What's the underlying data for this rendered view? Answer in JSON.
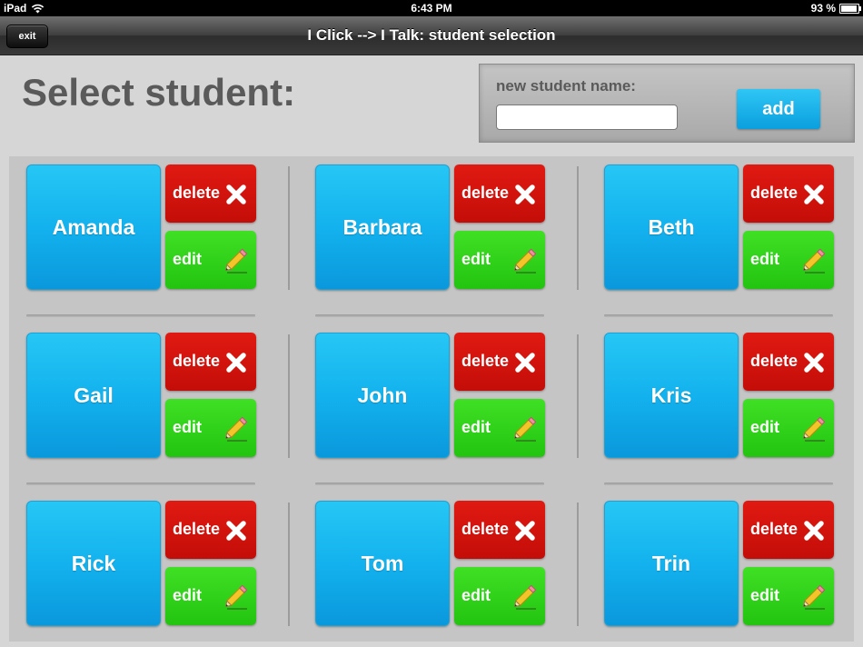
{
  "status_bar": {
    "device": "iPad",
    "time": "6:43 PM",
    "battery": "93 %",
    "battery_level": 0.93
  },
  "title_bar": {
    "exit_label": "exit",
    "title": "I Click --> I Talk: student selection"
  },
  "header": {
    "page_title": "Select student:",
    "new_student_label": "new student name:",
    "new_student_value": "",
    "add_label": "add"
  },
  "students": [
    {
      "name": "Amanda",
      "delete_label": "delete",
      "edit_label": "edit"
    },
    {
      "name": "Barbara",
      "delete_label": "delete",
      "edit_label": "edit"
    },
    {
      "name": "Beth",
      "delete_label": "delete",
      "edit_label": "edit"
    },
    {
      "name": "Gail",
      "delete_label": "delete",
      "edit_label": "edit"
    },
    {
      "name": "John",
      "delete_label": "delete",
      "edit_label": "edit"
    },
    {
      "name": "Kris",
      "delete_label": "delete",
      "edit_label": "edit"
    },
    {
      "name": "Rick",
      "delete_label": "delete",
      "edit_label": "edit"
    },
    {
      "name": "Tom",
      "delete_label": "delete",
      "edit_label": "edit"
    },
    {
      "name": "Trin",
      "delete_label": "delete",
      "edit_label": "edit"
    }
  ],
  "icons": {
    "wifi": "wifi-icon",
    "battery": "battery-icon",
    "delete": "x-icon",
    "edit": "pencil-icon"
  },
  "colors": {
    "name_button": "#13b2ee",
    "delete_button": "#d3140d",
    "edit_button": "#30d21a",
    "add_button": "#1ab4ee"
  }
}
